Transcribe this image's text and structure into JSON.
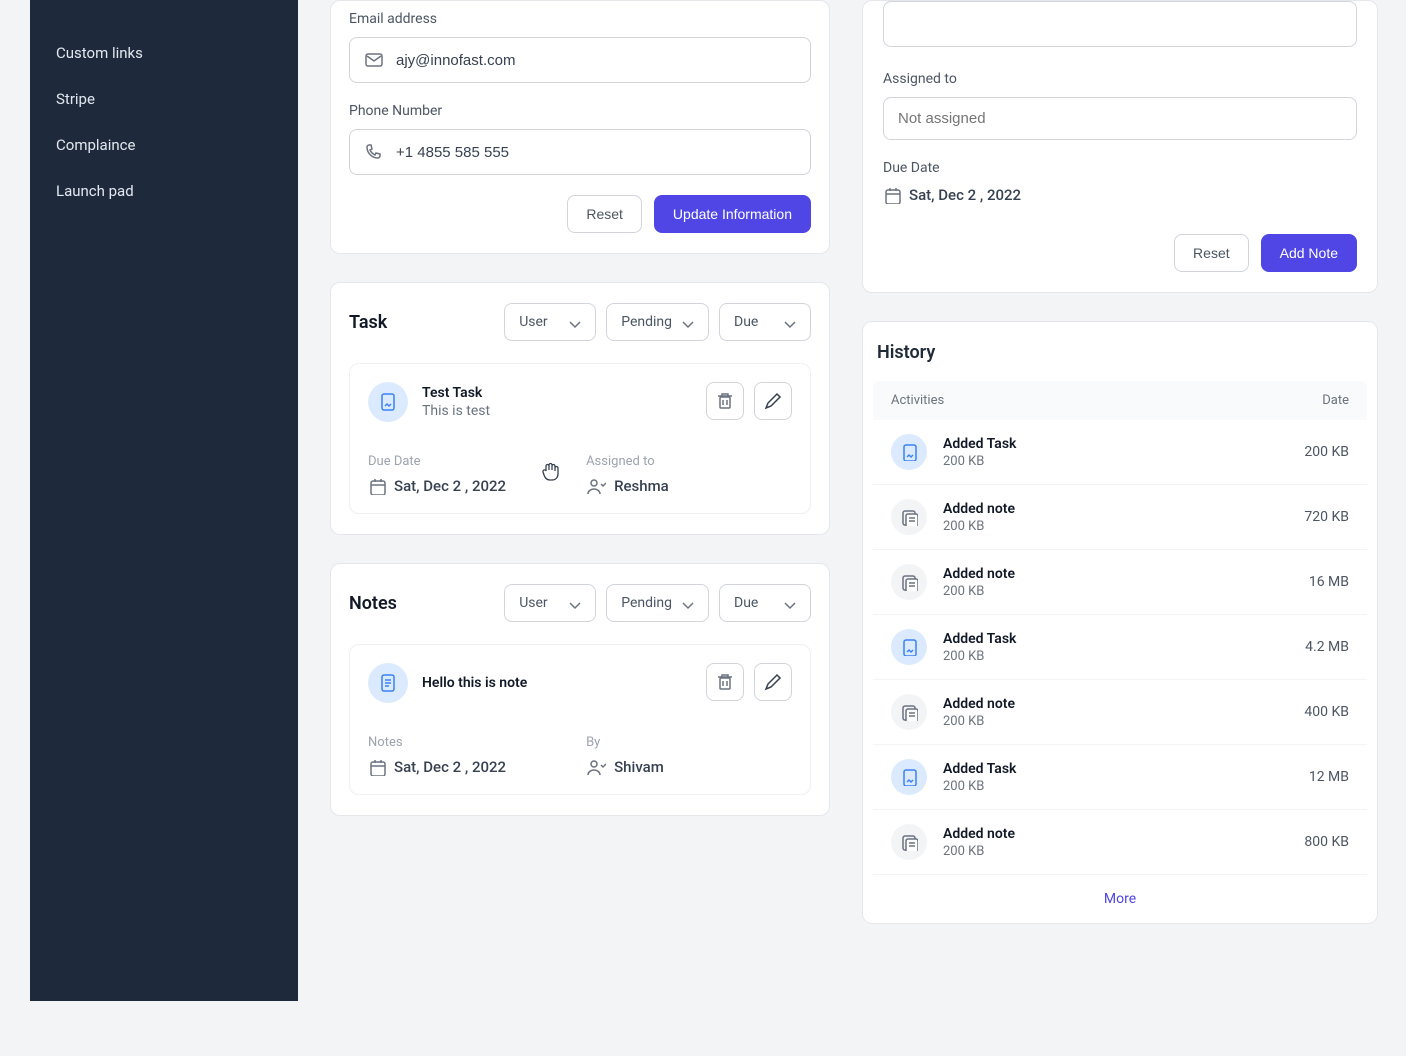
{
  "sidebar": {
    "items": [
      "Custom links",
      "Stripe",
      "Complaince",
      "Launch pad"
    ]
  },
  "form": {
    "email_label": "Email address",
    "email_value": "ajy@innofast.com",
    "phone_label": "Phone Number",
    "phone_value": "+1 4855 585 555",
    "reset": "Reset",
    "update": "Update Information"
  },
  "task_section": {
    "title": "Task",
    "filters": {
      "user": "User",
      "status": "Pending",
      "due": "Due"
    },
    "task": {
      "title": "Test Task",
      "subtitle": "This is test",
      "due_label": "Due Date",
      "due_value": "Sat, Dec 2 , 2022",
      "assigned_label": "Assigned to",
      "assigned_value": "Reshma"
    }
  },
  "notes_section": {
    "title": "Notes",
    "filters": {
      "user": "User",
      "status": "Pending",
      "due": "Due"
    },
    "note": {
      "title": "Hello this is note",
      "notes_label": "Notes",
      "notes_value": "Sat, Dec 2 , 2022",
      "by_label": "By",
      "by_value": "Shivam"
    }
  },
  "right_form": {
    "assigned_label": "Assigned to",
    "assigned_placeholder": "Not assigned",
    "due_label": "Due Date",
    "due_value": "Sat, Dec 2 , 2022",
    "reset": "Reset",
    "add_note": "Add Note"
  },
  "history": {
    "title": "History",
    "col_activities": "Activities",
    "col_date": "Date",
    "rows": [
      {
        "title": "Added Task",
        "sub": "200 KB",
        "size": "200 KB",
        "type": "task"
      },
      {
        "title": "Added note",
        "sub": "200 KB",
        "size": "720 KB",
        "type": "note"
      },
      {
        "title": "Added note",
        "sub": "200 KB",
        "size": "16 MB",
        "type": "note"
      },
      {
        "title": "Added Task",
        "sub": "200 KB",
        "size": "4.2 MB",
        "type": "task"
      },
      {
        "title": "Added note",
        "sub": "200 KB",
        "size": "400 KB",
        "type": "note"
      },
      {
        "title": "Added Task",
        "sub": "200 KB",
        "size": "12 MB",
        "type": "task"
      },
      {
        "title": "Added note",
        "sub": "200 KB",
        "size": "800 KB",
        "type": "note"
      }
    ],
    "more": "More"
  }
}
